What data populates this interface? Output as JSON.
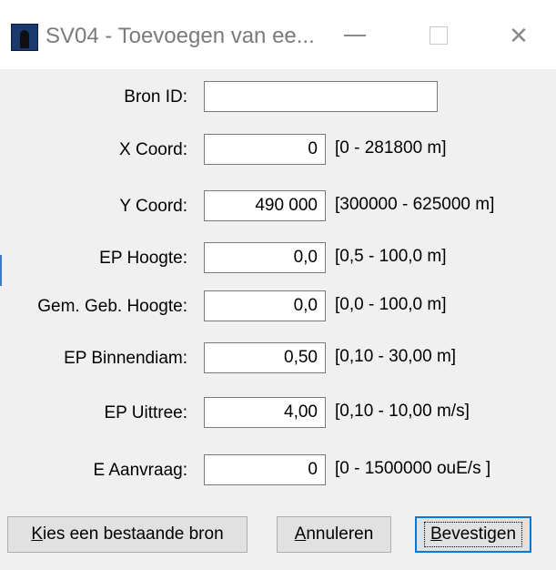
{
  "window": {
    "title": "SV04 - Toevoegen van ee...",
    "controls": {
      "minimize": "—",
      "maximize": "☐",
      "close": "✕"
    }
  },
  "form": {
    "bron_id": {
      "label": "Bron ID:",
      "value": ""
    },
    "x_coord": {
      "label": "X Coord:",
      "value": "0",
      "range": "[0 - 281800 m]"
    },
    "y_coord": {
      "label": "Y Coord:",
      "value": "490 000",
      "range": "[300000 - 625000 m]"
    },
    "ep_hoogte": {
      "label": "EP Hoogte:",
      "value": "0,0",
      "range": "[0,5 - 100,0 m]"
    },
    "gem_geb_hoogte": {
      "label": "Gem. Geb. Hoogte:",
      "value": "0,0",
      "range": "[0,0 - 100,0 m]"
    },
    "ep_binnendiam": {
      "label": "EP Binnendiam:",
      "value": "0,50",
      "range": "[0,10 - 30,00 m]"
    },
    "ep_uittree": {
      "label": "EP Uittree:",
      "value": "4,00",
      "range": "[0,10 - 10,00 m/s]"
    },
    "e_aanvraag": {
      "label": "E Aanvraag:",
      "value": "0",
      "range": "[0 - 1500000 ouE/s ]"
    }
  },
  "buttons": {
    "kies": {
      "accel": "K",
      "rest": "ies een bestaande bron"
    },
    "annuleren": {
      "accel": "A",
      "rest": "nnuleren"
    },
    "bevestigen": {
      "accel": "B",
      "rest": "evestigen"
    }
  },
  "colors": {
    "focus_border": "#0078d7",
    "background": "#f0f0f0"
  }
}
